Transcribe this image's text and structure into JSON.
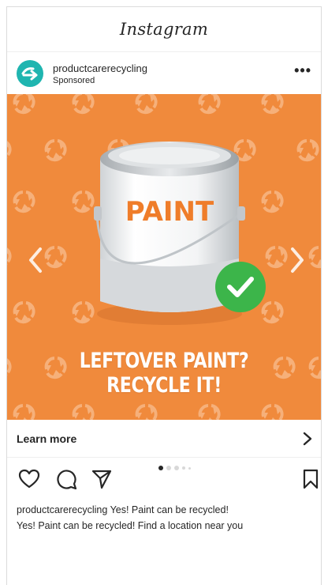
{
  "app": {
    "title": "Instagram"
  },
  "post": {
    "username": "productcarerecycling",
    "sponsored_label": "Sponsored",
    "more_label": "•••",
    "can_label": "PAINT",
    "headline_line1": "LEFTOVER PAINT?",
    "headline_line2": "RECYCLE IT!",
    "cta_label": "Learn more",
    "carousel": {
      "count": 5,
      "active": 1
    },
    "caption_user": "productcarerecycling",
    "caption_line1": "Yes! Paint can be recycled!",
    "caption_line2": "Yes! Paint can be recycled! Find a location near you"
  },
  "colors": {
    "ad_background": "#f08a3c",
    "avatar": "#1fb5b0",
    "check": "#3cb54a"
  },
  "icons": [
    "heart-icon",
    "comment-icon",
    "share-icon",
    "bookmark-icon",
    "chevron-right-icon",
    "prev-arrow-icon",
    "next-arrow-icon"
  ]
}
